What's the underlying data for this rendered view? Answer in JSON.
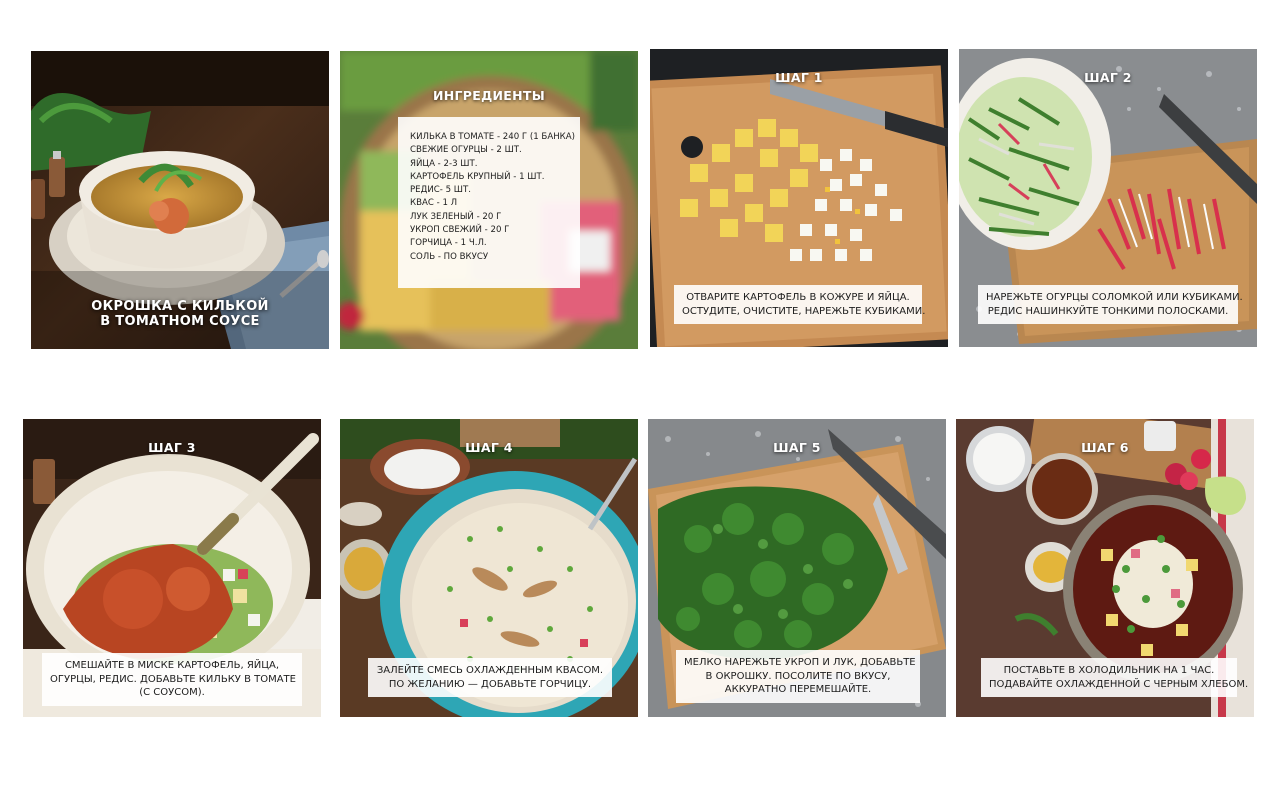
{
  "cover": {
    "title_line1": "ОКРОШКА С КИЛЬКОЙ",
    "title_line2": "В ТОМАТНОМ СОУСЕ"
  },
  "ingredients": {
    "title": "ИНГРЕДИЕНТЫ",
    "items": [
      "КИЛЬКА В ТОМАТЕ - 240 Г (1 БАНКА)",
      "СВЕЖИЕ ОГУРЦЫ - 2 ШТ.",
      "ЯЙЦА - 2-3 ШТ.",
      "КАРТОФЕЛЬ КРУПНЫЙ - 1 ШТ.",
      "РЕДИС- 5 ШТ.",
      "КВАС - 1 Л",
      "ЛУК ЗЕЛЕНЫЙ - 20 Г",
      "УКРОП СВЕЖИЙ - 20 Г",
      "ГОРЧИЦА - 1 Ч.Л.",
      "СОЛЬ - ПО ВКУСУ"
    ]
  },
  "steps": [
    {
      "title": "ШАГ 1",
      "lines": [
        "ОТВАРИТЕ КАРТОФЕЛЬ В КОЖУРЕ И ЯЙЦА.",
        "ОСТУДИТЕ, ОЧИСТИТЕ, НАРЕЖЬТЕ КУБИКАМИ."
      ]
    },
    {
      "title": "ШАГ 2",
      "lines": [
        "НАРЕЖЬТЕ ОГУРЦЫ СОЛОМКОЙ ИЛИ КУБИКАМИ.",
        "РЕДИС НАШИНКУЙТЕ ТОНКИМИ ПОЛОСКАМИ."
      ]
    },
    {
      "title": "ШАГ 3",
      "lines": [
        "СМЕШАЙТЕ В МИСКЕ КАРТОФЕЛЬ, ЯЙЦА,",
        "ОГУРЦЫ, РЕДИС. ДОБАВЬТЕ КИЛЬКУ В ТОМАТЕ",
        "(С СОУСОМ)."
      ]
    },
    {
      "title": "ШАГ 4",
      "lines": [
        "ЗАЛЕЙТЕ СМЕСЬ ОХЛАЖДЕННЫМ КВАСОМ.",
        "ПО ЖЕЛАНИЮ — ДОБАВЬТЕ ГОРЧИЦУ."
      ]
    },
    {
      "title": "ШАГ 5",
      "lines": [
        "МЕЛКО НАРЕЖЬТЕ УКРОП И ЛУК, ДОБАВЬТЕ",
        "В ОКРОШКУ. ПОСОЛИТЕ ПО ВКУСУ,",
        "АККУРАТНО ПЕРЕМЕШАЙТЕ."
      ]
    },
    {
      "title": "ШАГ 6",
      "lines": [
        "ПОСТАВЬТЕ В ХОЛОДИЛЬНИК НА 1 ЧАС.",
        "ПОДАВАЙТЕ ОХЛАЖДЕННОЙ С ЧЕРНЫМ ХЛЕБОМ."
      ]
    }
  ]
}
